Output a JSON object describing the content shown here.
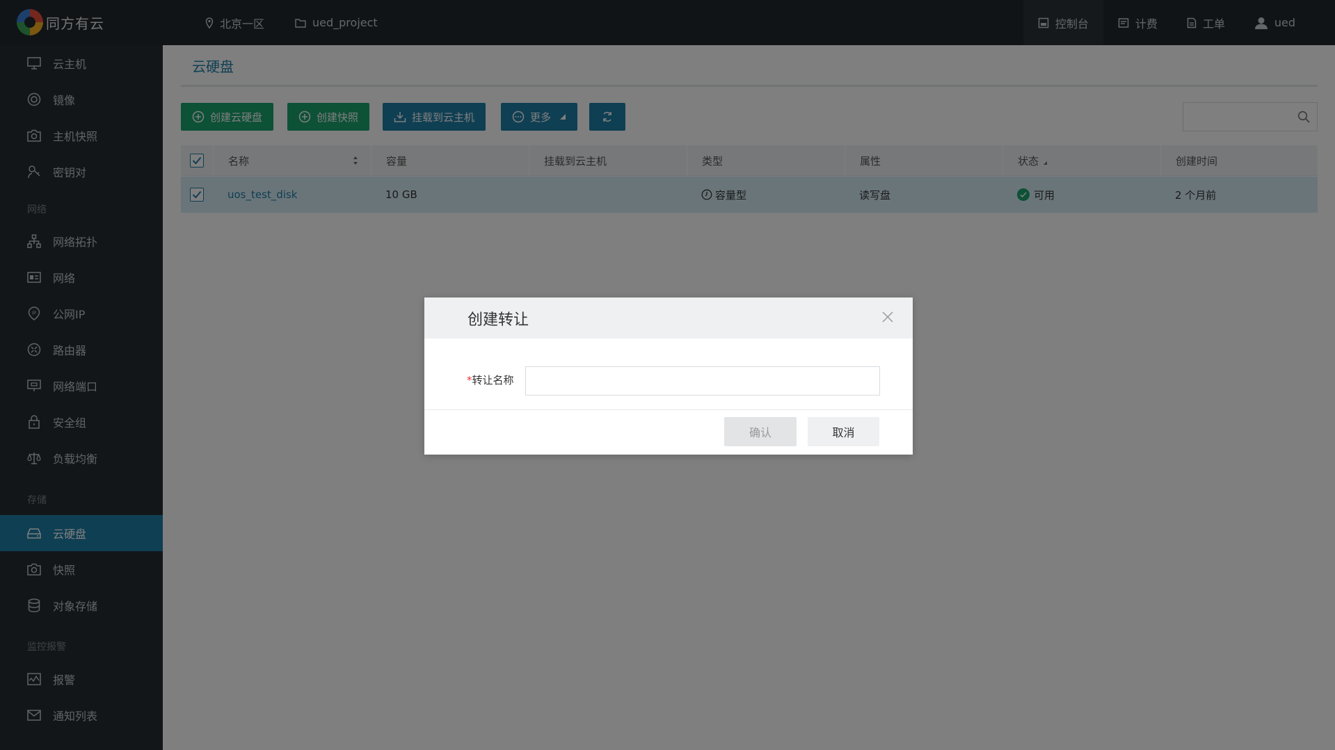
{
  "brand": {
    "name": "同方有云"
  },
  "topbar": {
    "region": "北京一区",
    "project": "ued_project",
    "right": [
      {
        "label": "控制台",
        "icon": "console-icon",
        "active": true
      },
      {
        "label": "计费",
        "icon": "billing-icon",
        "active": false
      },
      {
        "label": "工单",
        "icon": "ticket-icon",
        "active": false
      },
      {
        "label": "ued",
        "icon": "user-icon",
        "active": false
      }
    ]
  },
  "sidebar": {
    "items": [
      {
        "label": "云主机",
        "icon": "monitor-icon"
      },
      {
        "label": "镜像",
        "icon": "image-disc-icon"
      },
      {
        "label": "主机快照",
        "icon": "camera-icon"
      },
      {
        "label": "密钥对",
        "icon": "key-pair-icon"
      }
    ],
    "network_title": "网络",
    "network_items": [
      {
        "label": "网络拓扑",
        "icon": "topology-icon"
      },
      {
        "label": "网络",
        "icon": "network-card-icon"
      },
      {
        "label": "公网IP",
        "icon": "public-ip-icon"
      },
      {
        "label": "路由器",
        "icon": "router-icon"
      },
      {
        "label": "网络端口",
        "icon": "network-port-icon"
      },
      {
        "label": "安全组",
        "icon": "lock-icon"
      },
      {
        "label": "负载均衡",
        "icon": "balance-icon"
      }
    ],
    "storage_title": "存储",
    "storage_items": [
      {
        "label": "云硬盘",
        "icon": "disk-icon",
        "active": true
      },
      {
        "label": "快照",
        "icon": "camera-icon"
      },
      {
        "label": "对象存储",
        "icon": "database-icon"
      }
    ],
    "monitor_title": "监控报警",
    "monitor_items": [
      {
        "label": "报警",
        "icon": "alarm-chart-icon"
      },
      {
        "label": "通知列表",
        "icon": "mail-icon"
      }
    ]
  },
  "main": {
    "title": "云硬盘",
    "toolbar": {
      "create_disk": "创建云硬盘",
      "create_snapshot": "创建快照",
      "attach": "挂载到云主机",
      "more": "更多"
    },
    "table": {
      "columns": [
        "名称",
        "容量",
        "挂载到云主机",
        "类型",
        "属性",
        "状态",
        "创建时间"
      ],
      "rows": [
        {
          "name": "uos_test_disk",
          "capacity": "10 GB",
          "attached": "",
          "type": "容量型",
          "attr": "读写盘",
          "status": "可用",
          "created": "2 个月前"
        }
      ]
    }
  },
  "modal": {
    "title": "创建转让",
    "field_required_mark": "*",
    "field_label": "转让名称",
    "field_value": "",
    "confirm": "确认",
    "cancel": "取消"
  }
}
